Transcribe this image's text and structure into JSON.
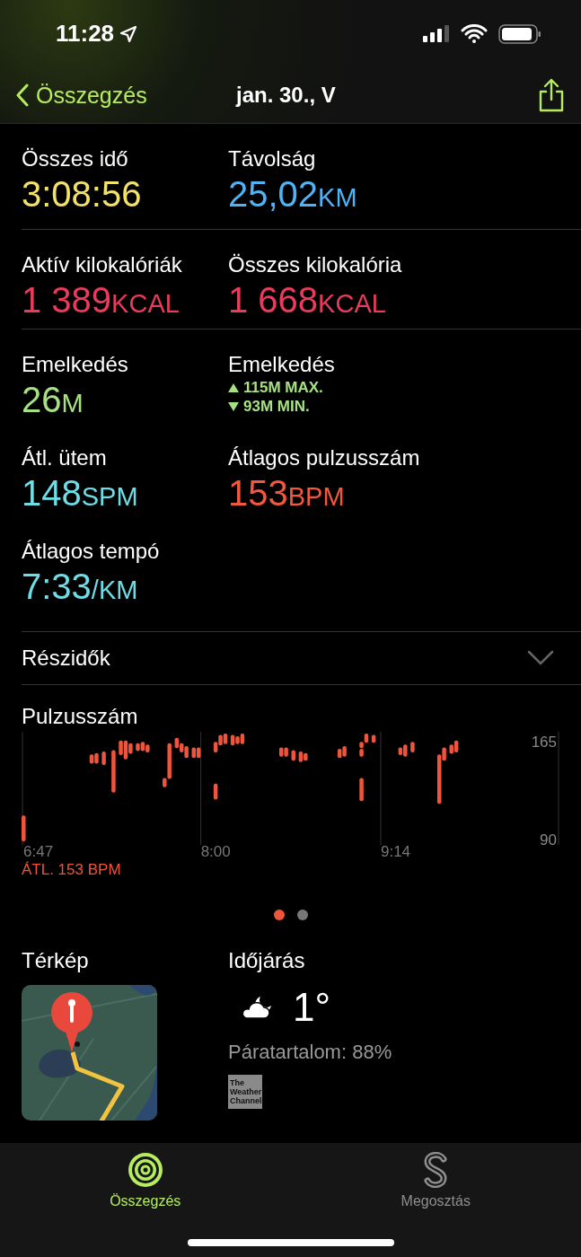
{
  "status_bar": {
    "time": "11:28"
  },
  "nav": {
    "back_label": "Összegzés",
    "title": "jan. 30., V"
  },
  "metric_groups": [
    {
      "rows": [
        [
          {
            "kind": "value",
            "label": "Összes idő",
            "value": "3:08:56",
            "color": "#f3e26a"
          },
          {
            "kind": "value",
            "label": "Távolság",
            "value": "25,02",
            "unit": "KM",
            "color": "#4fb3f5"
          }
        ]
      ]
    },
    {
      "rows": [
        [
          {
            "kind": "value",
            "label": "Aktív kilokalóriák",
            "value": "1 389",
            "unit": "KCAL",
            "color": "#ea3b5c"
          },
          {
            "kind": "value",
            "label": "Összes kilokalória",
            "value": "1 668",
            "unit": "KCAL",
            "color": "#ea3b5c"
          }
        ]
      ]
    },
    {
      "rows": [
        [
          {
            "kind": "value",
            "label": "Emelkedés",
            "value": "26",
            "unit": "M",
            "color": "#a6e281"
          },
          {
            "kind": "range",
            "label": "Emelkedés",
            "color": "#a6e281",
            "lines": [
              {
                "kind": "max",
                "text": "115M MAX."
              },
              {
                "kind": "min",
                "text": "93M MIN."
              }
            ]
          }
        ],
        [
          {
            "kind": "value",
            "label": "Átl. ütem",
            "value": "148",
            "unit": "SPM",
            "color": "#6fdde6"
          },
          {
            "kind": "value",
            "label": "Átlagos pulzusszám",
            "value": "153",
            "unit": "BPM",
            "color": "#f4573e"
          }
        ],
        [
          {
            "kind": "value",
            "label": "Átlagos tempó",
            "value": "7:33",
            "unit": "/KM",
            "color": "#6fdde6"
          }
        ]
      ]
    }
  ],
  "splits": {
    "label": "Részidők",
    "expanded": false
  },
  "heart_rate": {
    "title": "Pulzusszám",
    "average": "ÁTL. 153 BPM",
    "time_labels": [
      "6:47",
      "8:00",
      "9:14"
    ],
    "scale_labels": [
      "165",
      "90"
    ]
  },
  "pager": [
    {
      "selected": true
    },
    {
      "selected": false
    }
  ],
  "map": {
    "title": "Térkép",
    "kind": "picture"
  },
  "weather": {
    "title": "Időjárás",
    "temperature": "1°",
    "humidity": "Páratartalom: 88%",
    "source": "The Weather Channel"
  },
  "tabs": [
    {
      "label": "Összegzés",
      "selected": true,
      "kind": "rings"
    },
    {
      "label": "Megosztás",
      "selected": false,
      "kind": "sharing"
    }
  ]
}
